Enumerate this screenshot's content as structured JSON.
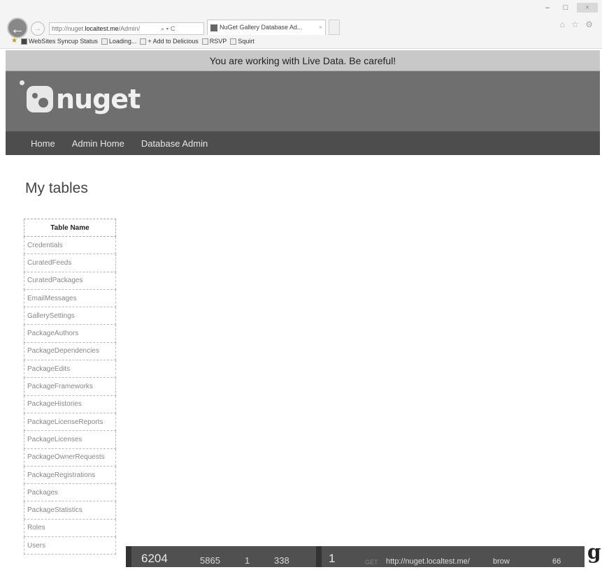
{
  "browser": {
    "address_url_prefix": "http://nuget.",
    "address_url_host": "localtest.me",
    "address_url_suffix": "/Admin/",
    "address_controls": "⌕ ▾ C",
    "tab_title": "NuGet Gallery Database Ad...",
    "tab_close": "×",
    "back_glyph": "←",
    "forward_glyph": "→",
    "window_controls": [
      "–",
      "□",
      "×"
    ],
    "right_icons": "⌂ ☆ ⚙",
    "favorites": [
      {
        "label": "WebSites Syncup Status",
        "icon": "page-icon"
      },
      {
        "label": "Loading...",
        "icon": "page-icon"
      },
      {
        "label": "+ Add to Delicious",
        "icon": "page-icon"
      },
      {
        "label": "RSVP",
        "icon": "page-icon"
      },
      {
        "label": "Squirt",
        "icon": "page-icon"
      }
    ]
  },
  "warning_text": "You are working with Live Data. Be careful!",
  "logo_text": "nuget",
  "nav": [
    "Home",
    "Admin Home",
    "Database Admin"
  ],
  "page_title": "My tables",
  "table": {
    "header": "Table Name",
    "rows": [
      "Credentials",
      "CuratedFeeds",
      "CuratedPackages",
      "EmailMessages",
      "GallerySettings",
      "PackageAuthors",
      "PackageDependencies",
      "PackageEdits",
      "PackageFrameworks",
      "PackageHistories",
      "PackageLicenseReports",
      "PackageLicenses",
      "PackageOwnerRequests",
      "PackageRegistrations",
      "Packages",
      "PackageStatistics",
      "Roles",
      "Users"
    ]
  },
  "status_bar": {
    "total": "6204",
    "host_time": "5865",
    "server_count": "1",
    "client_time": "338",
    "request_count": "1",
    "method": "GET",
    "url": "http://nuget.localtest.me/",
    "browser": "brow",
    "number": "66",
    "badge": "g"
  },
  "colors": {
    "header_bg": "#6f6f6f",
    "nav_bg": "#4d4d4d",
    "warning_bg": "#c8c8c8",
    "status_bg": "#505050"
  }
}
